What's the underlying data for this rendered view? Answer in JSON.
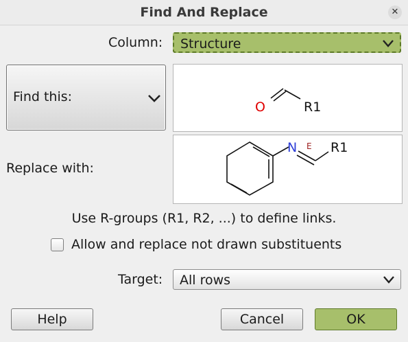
{
  "window": {
    "title": "Find And Replace",
    "close_glyph": "✕"
  },
  "column": {
    "label": "Column:",
    "value": "Structure"
  },
  "find": {
    "mode_label": "Find this:",
    "structure": {
      "atom_o": "O",
      "group": "R1"
    }
  },
  "replace": {
    "label": "Replace with:",
    "structure": {
      "atom_n": "N",
      "stereo": "E",
      "group": "R1"
    }
  },
  "info_text": "Use R-groups (R1, R2, ...) to define links.",
  "checkbox": {
    "label": "Allow and replace not drawn substituents",
    "checked": false
  },
  "target": {
    "label": "Target:",
    "value": "All rows"
  },
  "buttons": {
    "help": "Help",
    "cancel": "Cancel",
    "ok": "OK"
  },
  "colors": {
    "accent": "#a7bf6b",
    "oxygen": "#e00000",
    "nitrogen": "#2f3fd8",
    "stereo": "#9b1c1c"
  },
  "icons": {
    "dropdown": "chevron-down-icon",
    "close": "close-icon"
  }
}
